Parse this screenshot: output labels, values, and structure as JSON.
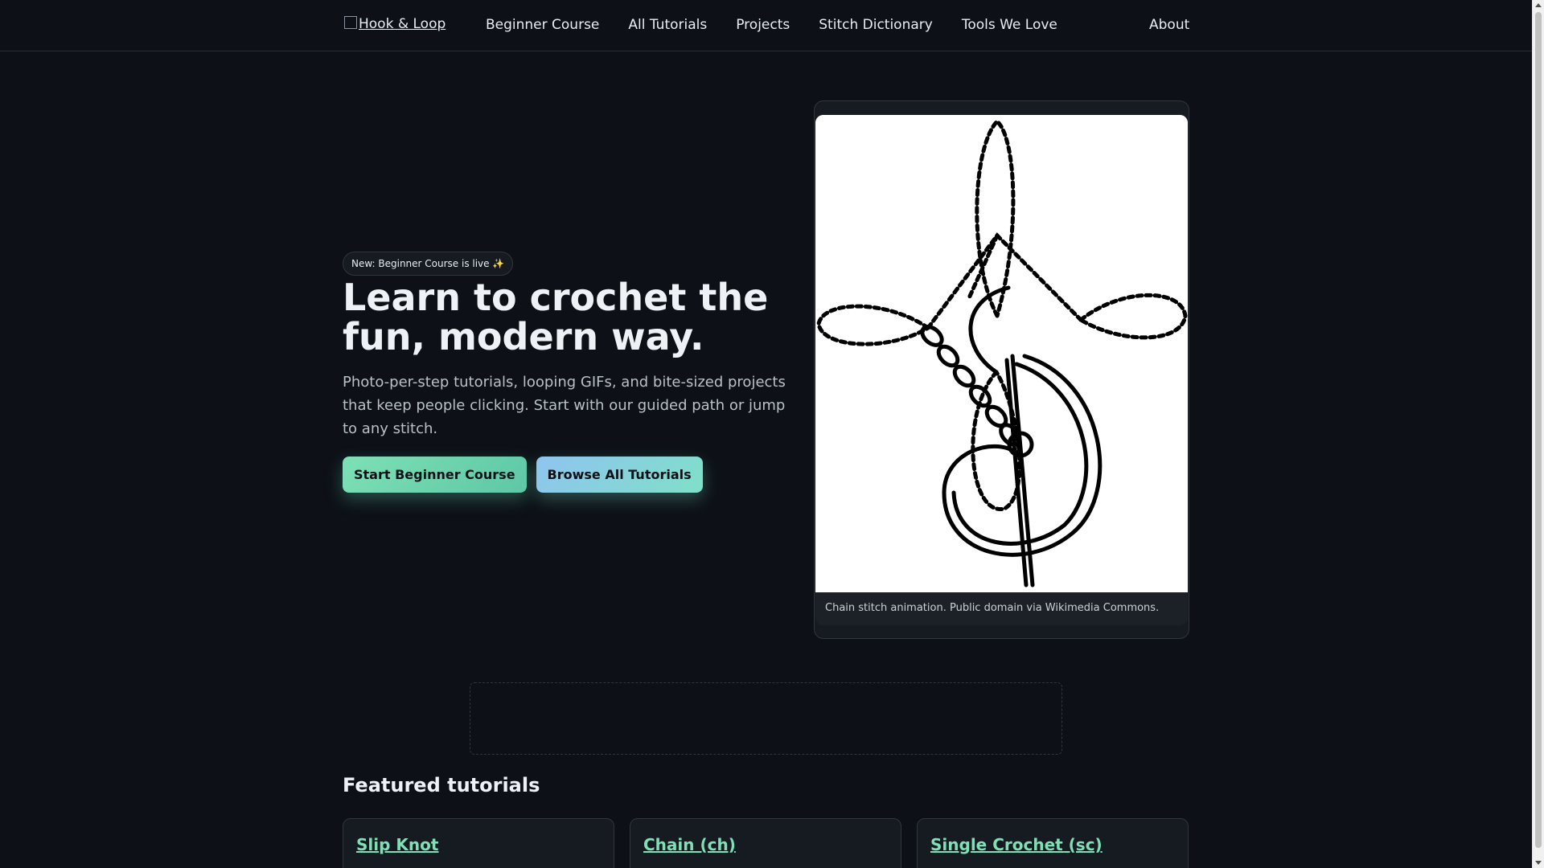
{
  "header": {
    "logo_alt": "Hook & Loop",
    "nav": [
      "Beginner Course",
      "All Tutorials",
      "Projects",
      "Stitch Dictionary",
      "Tools We Love"
    ],
    "about": "About"
  },
  "hero": {
    "badge": "New: Beginner Course is live ✨",
    "title": "Learn to crochet the fun, modern way.",
    "subtitle": "Photo-per-step tutorials, looping GIFs, and bite-sized projects that keep people clicking. Start with our guided path or jump to any stitch.",
    "primary_cta": "Start Beginner Course",
    "secondary_cta": "Browse All Tutorials",
    "image_caption": "Chain stitch animation. Public domain via Wikimedia Commons."
  },
  "featured": {
    "title": "Featured tutorials",
    "cards": [
      "Slip Knot",
      "Chain (ch)",
      "Single Crochet (sc)"
    ]
  },
  "colors": {
    "background": "#0d1117",
    "accent": "#7ee0b5",
    "card": "#161b22"
  }
}
